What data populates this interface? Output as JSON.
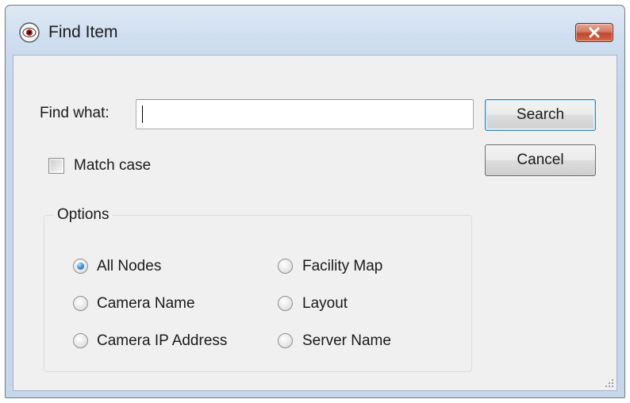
{
  "window": {
    "title": "Find Item",
    "icon": "eye-icon",
    "close_icon": "close-icon"
  },
  "form": {
    "find_label": "Find what:",
    "find_value": "",
    "match_case_label": "Match case",
    "match_case_checked": false
  },
  "buttons": {
    "search_label": "Search",
    "cancel_label": "Cancel"
  },
  "options": {
    "title": "Options",
    "selected": "All Nodes",
    "items": [
      {
        "label": "All Nodes",
        "checked": true
      },
      {
        "label": "Camera Name",
        "checked": false
      },
      {
        "label": "Camera IP Address",
        "checked": false
      },
      {
        "label": "Facility Map",
        "checked": false
      },
      {
        "label": "Layout",
        "checked": false
      },
      {
        "label": "Server Name",
        "checked": false
      }
    ]
  },
  "colors": {
    "titlebar": "#cfdef0",
    "close_button": "#c0452c",
    "dialog_background": "#f0f0f0",
    "default_button_border": "#3c7fb1",
    "radio_selected": "#3d8fd0"
  }
}
